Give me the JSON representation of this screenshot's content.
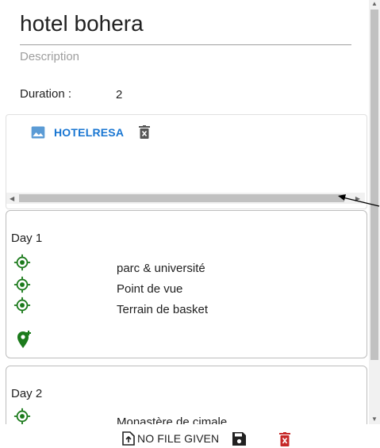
{
  "form": {
    "title": "hotel bohera",
    "description_placeholder": "Description",
    "duration_label": "Duration :",
    "duration_value": "2"
  },
  "attachment": {
    "name": "HOTELRESA",
    "icon": "image-icon",
    "delete_icon": "delete-icon"
  },
  "days": [
    {
      "title": "Day 1",
      "pois": [
        "parc & université",
        "Point de vue",
        "Terrain de basket"
      ]
    },
    {
      "title": "Day 2",
      "pois": [
        "Monastère de cimale"
      ]
    }
  ],
  "footer": {
    "upload_label": "NO FILE GIVEN",
    "save_icon": "save-icon",
    "delete_icon": "delete-icon"
  },
  "colors": {
    "accent_blue": "#1976d2",
    "poi_green": "#1b7a1b",
    "delete_red": "#c62828"
  }
}
